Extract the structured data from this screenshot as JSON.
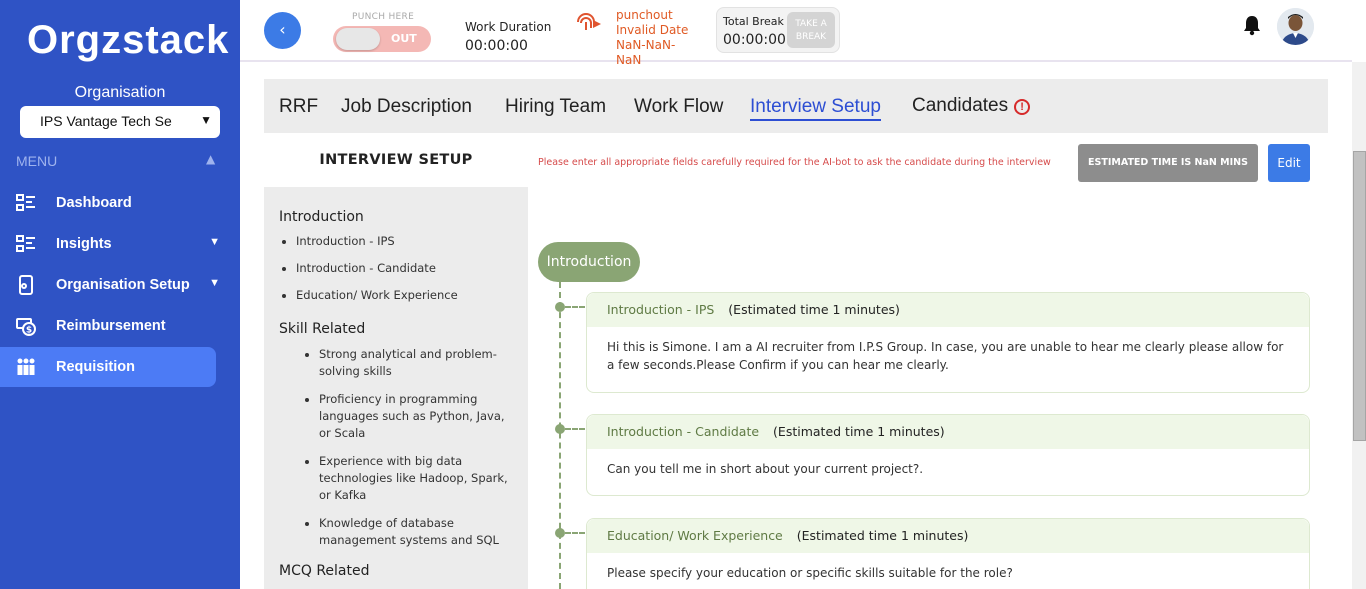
{
  "sidebar": {
    "logo": "Orgzstack",
    "org_label": "Organisation",
    "org_selected": "IPS Vantage Tech Se",
    "menu_label": "MENU",
    "items": [
      {
        "label": "Dashboard",
        "icon": "list-icon",
        "has_chevron": false
      },
      {
        "label": "Insights",
        "icon": "list-icon",
        "has_chevron": true
      },
      {
        "label": "Organisation Setup",
        "icon": "device-gear-icon",
        "has_chevron": true
      },
      {
        "label": "Reimbursement",
        "icon": "money-refresh-icon",
        "has_chevron": false
      },
      {
        "label": "Requisition",
        "icon": "team-icon",
        "has_chevron": false,
        "active": true
      }
    ]
  },
  "topbar": {
    "back_icon": "‹",
    "punch_label": "PUNCH HERE",
    "punch_state": "OUT",
    "work_duration_label": "Work Duration",
    "work_duration_value": "00:00:00",
    "punchout_icon": "fingerprint-icon",
    "punchout_text_1": "punchout",
    "punchout_text_2": "Invalid Date",
    "punchout_text_3": "NaN-NaN-",
    "punchout_text_4": "NaN",
    "total_break_label": "Total Break",
    "total_break_value": "00:00:00",
    "take_break_line1": "TAKE A",
    "take_break_line2": "BREAK"
  },
  "tabs": [
    "RRF",
    "Job Description",
    "Hiring Team",
    "Work Flow",
    "Interview Setup",
    "Candidates"
  ],
  "active_tab": "Interview Setup",
  "outline": {
    "title": "INTERVIEW SETUP",
    "sections": [
      {
        "title": "Introduction",
        "items": [
          "Introduction - IPS",
          "Introduction - Candidate",
          "Education/ Work Experience"
        ]
      },
      {
        "title": "Skill Related",
        "items": [
          "Strong analytical and problem-solving skills",
          "Proficiency in programming languages such as Python, Java, or Scala",
          "Experience with big data technologies like Hadoop, Spark, or Kafka",
          "Knowledge of database management systems and SQL"
        ]
      },
      {
        "title": "MCQ Related",
        "items": []
      }
    ]
  },
  "info": {
    "message": "Please enter all appropriate fields carefully required for the AI-bot to ask the candidate during the interview",
    "estimated_time": "ESTIMATED TIME IS NaN MINS",
    "edit_label": "Edit"
  },
  "timeline": {
    "section_label": "Introduction",
    "questions": [
      {
        "title": "Introduction - IPS",
        "estimate": "(Estimated time 1 minutes)",
        "body": "Hi this is Simone. I am a AI recruiter from I.P.S Group. In case, you are unable to hear me clearly please allow for a few seconds.Please Confirm if you can hear me clearly."
      },
      {
        "title": "Introduction - Candidate",
        "estimate": "(Estimated time 1 minutes)",
        "body": "Can you tell me in short about your current project?."
      },
      {
        "title": "Education/ Work Experience",
        "estimate": "(Estimated time 1 minutes)",
        "body": "Please specify your education or specific skills suitable for the role?"
      }
    ]
  },
  "colors": {
    "sidebar_bg": "#2f53c5",
    "sidebar_active": "#4c7bf5",
    "accent_blue": "#3c7be6",
    "active_tab": "#2d4ed3",
    "timeline_green": "#8aa574",
    "warning_red": "#d62a2a"
  }
}
